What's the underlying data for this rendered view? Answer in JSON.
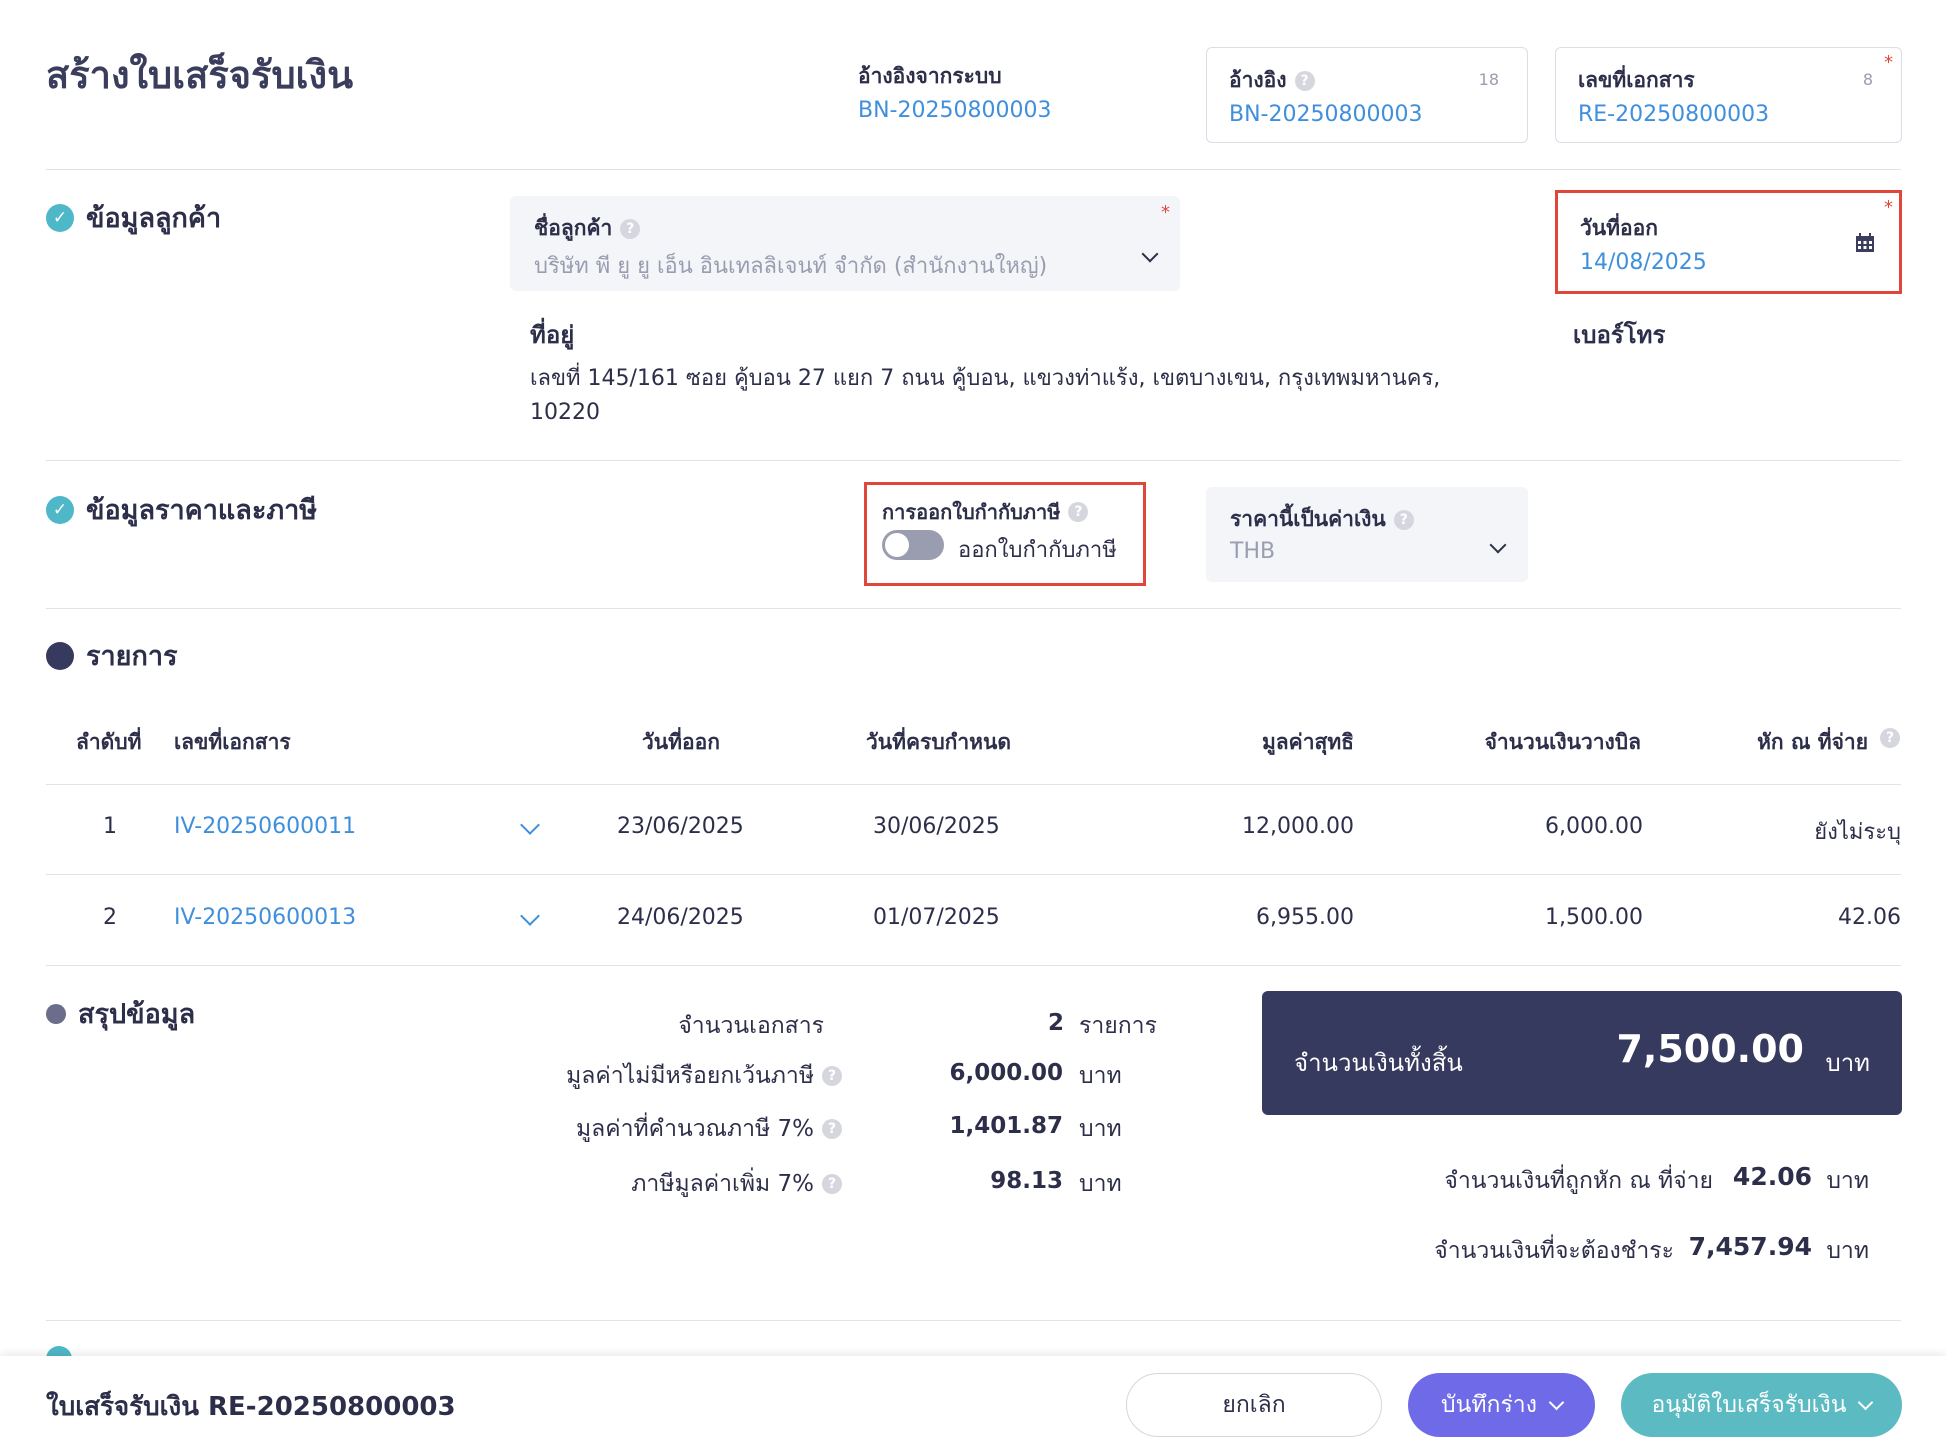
{
  "header": {
    "title": "สร้างใบเสร็จรับเงิน",
    "system_ref_label": "อ้างอิงจากระบบ",
    "system_ref_value": "BN-20250800003",
    "ref_label": "อ้างอิง",
    "ref_value": "BN-20250800003",
    "ref_count": "18",
    "doc_no_label": "เลขที่เอกสาร",
    "doc_no_value": "RE-20250800003",
    "doc_no_count": "8",
    "required_mark": "*"
  },
  "customer": {
    "section_title": "ข้อมูลลูกค้า",
    "name_label": "ชื่อลูกค้า",
    "name_value": "บริษัท พี ยู ยู เอ็น อินเทลลิเจนท์ จำกัด (สำนักงานใหญ่)",
    "issue_date_label": "วันที่ออก",
    "issue_date_value": "14/08/2025",
    "address_label": "ที่อยู่",
    "address_line1": "เลขที่ 145/161 ซอย คู้บอน 27 แยก 7 ถนน คู้บอน, แขวงท่าแร้ง, เขตบางเขน, กรุงเทพมหานคร,",
    "address_line2": "10220",
    "phone_label": "เบอร์โทร"
  },
  "pricing": {
    "section_title": "ข้อมูลราคาและภาษี",
    "tax_invoice_label": "การออกใบกำกับภาษี",
    "tax_invoice_toggle_label": "ออกใบกำกับภาษี",
    "currency_label": "ราคานี้เป็นค่าเงิน",
    "currency_value": "THB"
  },
  "items": {
    "section_title": "รายการ",
    "columns": [
      "ลำดับที่",
      "เลขที่เอกสาร",
      "วันที่ออก",
      "วันที่ครบกำหนด",
      "มูลค่าสุทธิ",
      "จำนวนเงินวางบิล",
      "หัก ณ ที่จ่าย"
    ],
    "rows": [
      {
        "no": "1",
        "doc": "IV-20250600011",
        "issue": "23/06/2025",
        "due": "30/06/2025",
        "net": "12,000.00",
        "billed": "6,000.00",
        "wht": "ยังไม่ระบุ"
      },
      {
        "no": "2",
        "doc": "IV-20250600013",
        "issue": "24/06/2025",
        "due": "01/07/2025",
        "net": "6,955.00",
        "billed": "1,500.00",
        "wht": "42.06"
      }
    ]
  },
  "summary": {
    "section_title": "สรุปข้อมูล",
    "doc_count_label": "จำนวนเอกสาร",
    "doc_count_value": "2",
    "doc_count_unit": "รายการ",
    "non_vat_label": "มูลค่าไม่มีหรือยกเว้นภาษี",
    "non_vat_value": "6,000.00",
    "vat_base_label": "มูลค่าที่คำนวณภาษี 7%",
    "vat_base_value": "1,401.87",
    "vat_label": "ภาษีมูลค่าเพิ่ม 7%",
    "vat_value": "98.13",
    "unit": "บาท",
    "total_label": "จำนวนเงินทั้งสิ้น",
    "total_value": "7,500.00",
    "wht_label": "จำนวนเงินที่ถูกหัก ณ ที่จ่าย",
    "wht_value": "42.06",
    "payable_label": "จำนวนเงินที่จะต้องชำระ",
    "payable_value": "7,457.94"
  },
  "footer": {
    "doc_title": "ใบเสร็จรับเงิน RE-20250800003",
    "cancel_label": "ยกเลิก",
    "draft_label": "บันทึกร่าง",
    "approve_label": "อนุมัติใบเสร็จรับเงิน"
  },
  "colors": {
    "accent_blue": "#3f8fdc",
    "navy": "#363a5e",
    "draft_button": "#6f6ae8",
    "approve_button": "#5bbac2",
    "highlight_red": "#e0473a"
  }
}
